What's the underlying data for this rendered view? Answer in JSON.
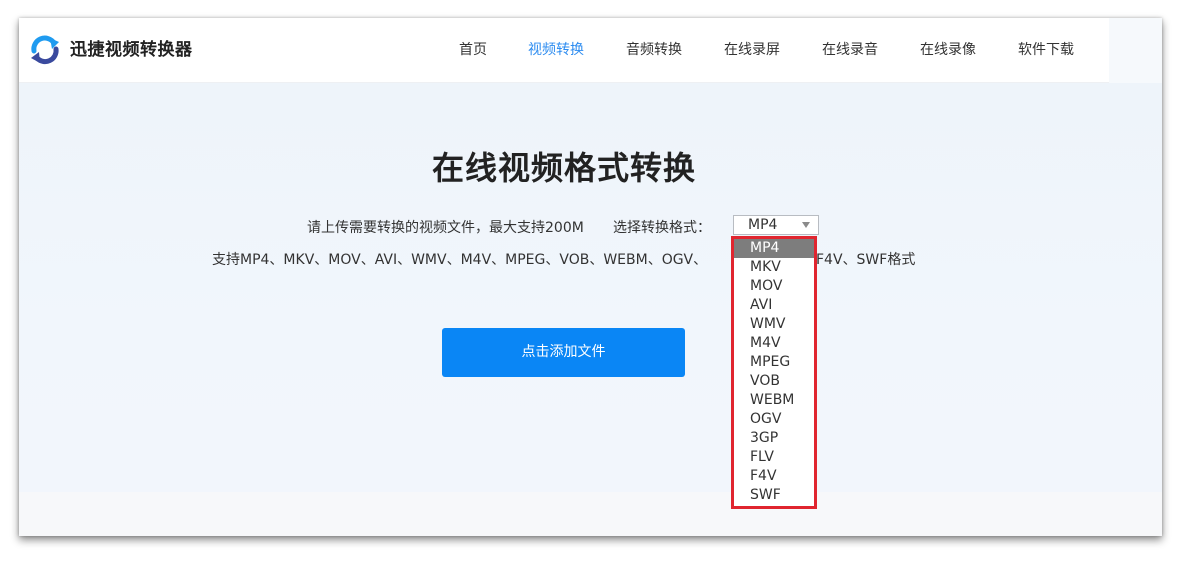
{
  "brand": {
    "name": "迅捷视频转换器",
    "logo_icon": "refresh-arrows-icon",
    "logo_colors": [
      "#1f9bf0",
      "#3a4a9e"
    ]
  },
  "nav": {
    "items": [
      {
        "label": "首页",
        "active": false
      },
      {
        "label": "视频转换",
        "active": true
      },
      {
        "label": "音频转换",
        "active": false
      },
      {
        "label": "在线录屏",
        "active": false
      },
      {
        "label": "在线录音",
        "active": false
      },
      {
        "label": "在线录像",
        "active": false
      },
      {
        "label": "软件下载",
        "active": false
      }
    ]
  },
  "main": {
    "title": "在线视频格式转换",
    "upload_hint": "请上传需要转换的视频文件，最大支持200M",
    "format_label": "选择转换格式：",
    "format_select": {
      "value": "MP4",
      "arrow_icon": "caret-down-icon"
    },
    "supported_prefix": "支持MP4、MKV、MOV、AVI、WMV、M4V、MPEG、VOB、WEBM、OGV、",
    "supported_suffix": "F4V、SWF格式",
    "add_button": "点击添加文件"
  },
  "dropdown": {
    "options": [
      "MP4",
      "MKV",
      "MOV",
      "AVI",
      "WMV",
      "M4V",
      "MPEG",
      "VOB",
      "WEBM",
      "OGV",
      "3GP",
      "FLV",
      "F4V",
      "SWF"
    ],
    "selected": "MP4",
    "highlight_color": "#e0252f"
  },
  "colors": {
    "accent": "#2d8cf0",
    "button": "#0a86f5"
  }
}
